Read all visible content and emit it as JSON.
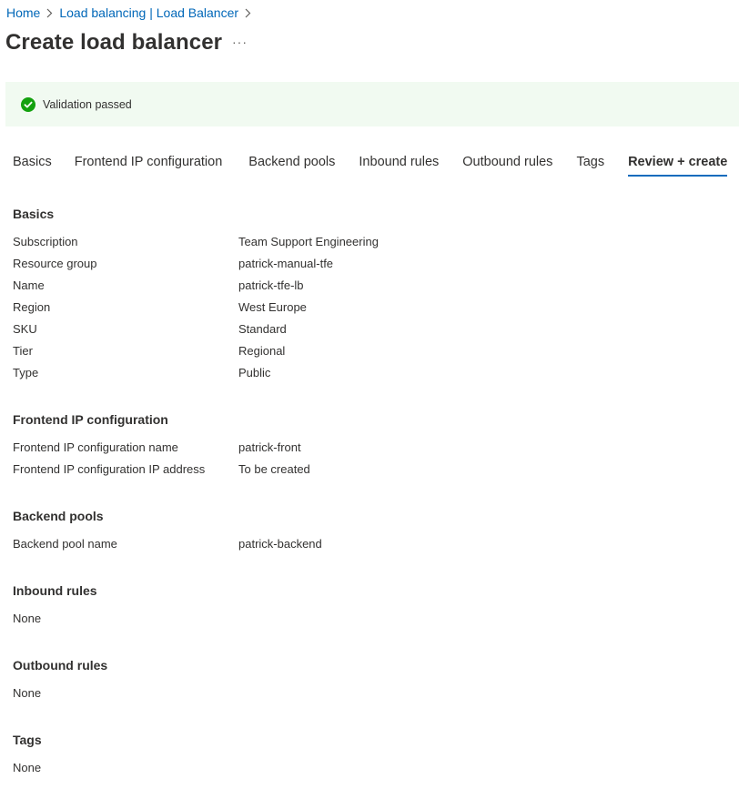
{
  "breadcrumb": {
    "home": "Home",
    "parent": "Load balancing | Load Balancer"
  },
  "page": {
    "title": "Create load balancer",
    "more": "···"
  },
  "validation": {
    "text": "Validation passed",
    "status_color": "#13a10e",
    "icon": "check-circle-icon"
  },
  "tabs": [
    "Basics",
    "Frontend IP configuration",
    "Backend pools",
    "Inbound rules",
    "Outbound rules",
    "Tags",
    "Review + create"
  ],
  "active_tab": "Review + create",
  "accent_color": "#0f6cbd",
  "sections": {
    "basics": {
      "heading": "Basics",
      "rows": [
        {
          "label": "Subscription",
          "value": "Team Support Engineering"
        },
        {
          "label": "Resource group",
          "value": "patrick-manual-tfe"
        },
        {
          "label": "Name",
          "value": "patrick-tfe-lb"
        },
        {
          "label": "Region",
          "value": "West Europe"
        },
        {
          "label": "SKU",
          "value": "Standard"
        },
        {
          "label": "Tier",
          "value": "Regional"
        },
        {
          "label": "Type",
          "value": "Public"
        }
      ]
    },
    "frontend": {
      "heading": "Frontend IP configuration",
      "rows": [
        {
          "label": "Frontend IP configuration name",
          "value": "patrick-front"
        },
        {
          "label": "Frontend IP configuration IP address",
          "value": "To be created"
        }
      ]
    },
    "backend": {
      "heading": "Backend pools",
      "rows": [
        {
          "label": "Backend pool name",
          "value": "patrick-backend"
        }
      ]
    },
    "inbound": {
      "heading": "Inbound rules",
      "value": "None"
    },
    "outbound": {
      "heading": "Outbound rules",
      "value": "None"
    },
    "tags": {
      "heading": "Tags",
      "value": "None"
    }
  }
}
